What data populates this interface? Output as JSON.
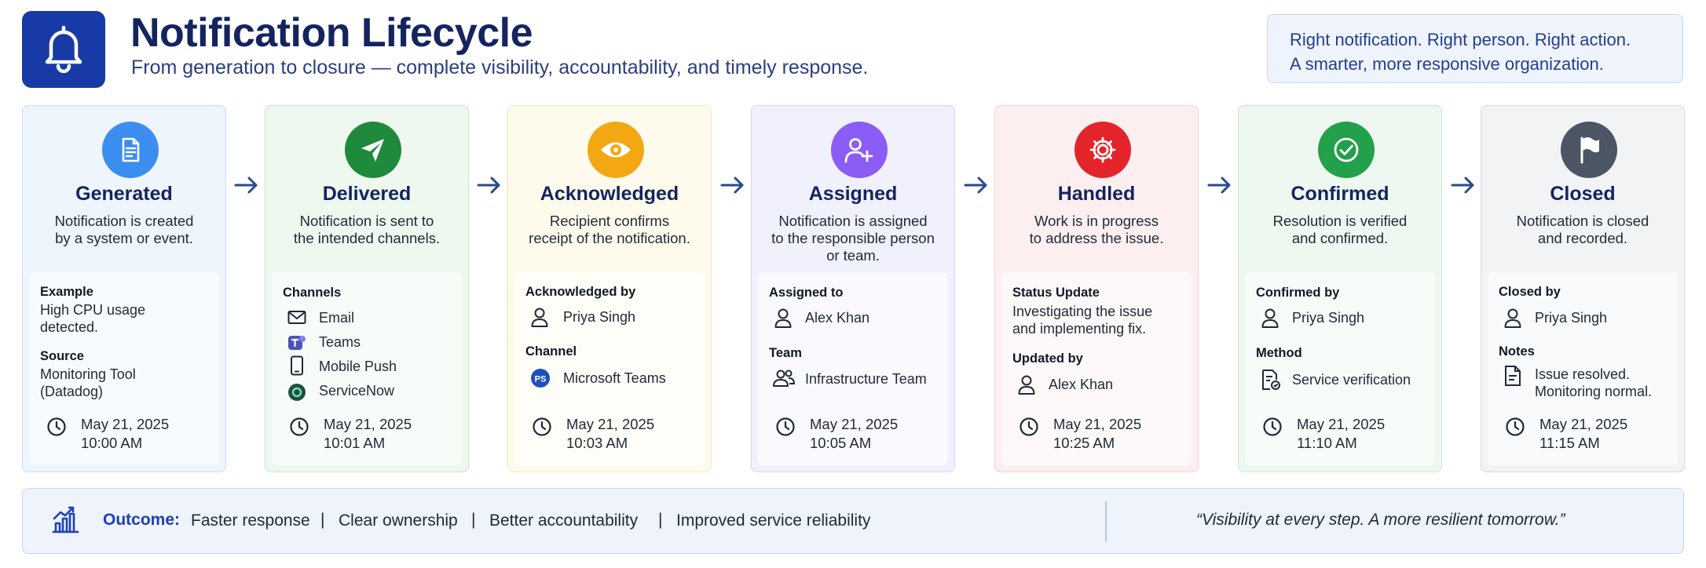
{
  "header": {
    "title": "Notification Lifecycle",
    "subtitle": "From generation to closure — complete visibility, accountability, and timely response.",
    "logo_icon": "bell-icon",
    "tagline": [
      "Right notification. Right person. Right action.",
      "A smarter, more responsive organization."
    ]
  },
  "stages": [
    {
      "title": "Generated",
      "icon": "document-icon",
      "color": "#3b8ef0",
      "desc": "Notification is created\nby a system or event.",
      "fields": [
        {
          "label": "Example",
          "value": "High CPU usage\ndetected."
        },
        {
          "label": "Source",
          "value": "Monitoring Tool\n(Datadog)"
        }
      ],
      "date": "May 21, 2025",
      "time": "10:00 AM"
    },
    {
      "title": "Delivered",
      "icon": "paper-plane-icon",
      "color": "#1f8a3b",
      "desc": "Notification is sent to\nthe intended channels.",
      "channels_label": "Channels",
      "channels": [
        {
          "icon": "email-icon",
          "name": "Email"
        },
        {
          "icon": "teams-icon",
          "name": "Teams"
        },
        {
          "icon": "mobile-icon",
          "name": "Mobile Push"
        },
        {
          "icon": "servicenow-icon",
          "name": "ServiceNow"
        }
      ],
      "date": "May 21, 2025",
      "time": "10:01 AM"
    },
    {
      "title": "Acknowledged",
      "icon": "eye-icon",
      "color": "#f2a713",
      "desc": "Recipient confirms\nreceipt of the notification.",
      "fields": [
        {
          "label": "Acknowledged by",
          "value": "Priya Singh",
          "icon": "person-icon"
        },
        {
          "label": "Channel",
          "value": "Microsoft Teams",
          "icon": "teams-badge-icon",
          "badge": "PS"
        }
      ],
      "date": "May 21, 2025",
      "time": "10:03 AM"
    },
    {
      "title": "Assigned",
      "icon": "assign-user-icon",
      "color": "#8b5cf6",
      "desc": "Notification is assigned\nto the responsible person\nor team.",
      "fields": [
        {
          "label": "Assigned to",
          "value": "Alex Khan",
          "icon": "person-icon"
        },
        {
          "label": "Team",
          "value": "Infrastructure Team",
          "icon": "team-icon"
        }
      ],
      "date": "May 21, 2025",
      "time": "10:05 AM"
    },
    {
      "title": "Handled",
      "icon": "gear-icon",
      "color": "#e3242b",
      "desc": "Work is in progress\nto address the issue.",
      "fields": [
        {
          "label": "Status Update",
          "value": "Investigating the issue\nand implementing fix."
        },
        {
          "label": "Updated by",
          "value": "Alex Khan",
          "icon": "person-icon"
        }
      ],
      "date": "May 21, 2025",
      "time": "10:25 AM"
    },
    {
      "title": "Confirmed",
      "icon": "check-circle-icon",
      "color": "#22a04b",
      "desc": "Resolution is verified\nand confirmed.",
      "fields": [
        {
          "label": "Confirmed by",
          "value": "Priya Singh",
          "icon": "person-icon"
        },
        {
          "label": "Method",
          "value": "Service verification",
          "icon": "doc-check-icon"
        }
      ],
      "date": "May 21, 2025",
      "time": "11:10 AM"
    },
    {
      "title": "Closed",
      "icon": "flag-icon",
      "color": "#4b5563",
      "desc": "Notification is closed\nand recorded.",
      "fields": [
        {
          "label": "Closed by",
          "value": "Priya Singh",
          "icon": "person-icon"
        },
        {
          "label": "Notes",
          "value": "Issue resolved.\nMonitoring normal.",
          "icon": "note-icon"
        }
      ],
      "date": "May 21, 2025",
      "time": "11:15 AM"
    }
  ],
  "footer": {
    "icon": "bar-chart-icon",
    "outcome_label": "Outcome:",
    "outcomes": [
      "Faster response",
      "Clear ownership",
      "Better accountability",
      "Improved service reliability"
    ],
    "separator": "|",
    "quote": "“Visibility at every step. A more resilient tomorrow.”"
  },
  "colors": {
    "card_bg": [
      "#eef5fd",
      "#eef8ef",
      "#fefbec",
      "#f1f0fd",
      "#fdeff0",
      "#eef8f0",
      "#f1f3f5"
    ],
    "card_border": [
      "#c9def5",
      "#c8e6cd",
      "#f6e7b5",
      "#d8d2f5",
      "#f5cfd2",
      "#c8e6cf",
      "#d4d9df"
    ],
    "arrow": "#2b4a8c",
    "title": "#14245e",
    "accent": "#1d3fb8"
  }
}
